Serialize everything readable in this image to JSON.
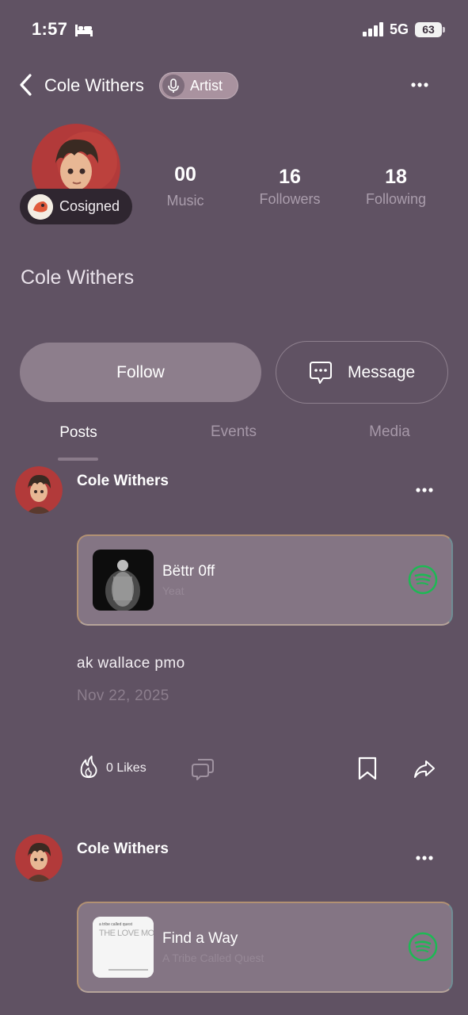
{
  "status_bar": {
    "time": "1:57",
    "network": "5G",
    "battery": "63"
  },
  "header": {
    "title": "Cole Withers",
    "badge": "Artist"
  },
  "profile": {
    "name": "Cole Withers",
    "cosigned_label": "Cosigned",
    "stats": [
      {
        "value": "00",
        "label": "Music"
      },
      {
        "value": "16",
        "label": "Followers"
      },
      {
        "value": "18",
        "label": "Following"
      }
    ]
  },
  "actions": {
    "follow": "Follow",
    "message": "Message"
  },
  "tabs": [
    "Posts",
    "Events",
    "Media"
  ],
  "active_tab": "Posts",
  "posts": [
    {
      "author": "Cole Withers",
      "track": {
        "title": "Bëttr 0ff",
        "artist": "Yeat"
      },
      "text": "ak wallace pmo",
      "date": "Nov 22, 2025",
      "likes": "0 Likes"
    },
    {
      "author": "Cole Withers",
      "track": {
        "title": "Find a Way",
        "artist": "A Tribe Called Quest",
        "art_text": "THE LOVE MOVEMENT",
        "art_small_text": "a tribe called quest"
      }
    }
  ],
  "colors": {
    "background": "#605263",
    "accent_follow": "#8d7e8c",
    "spotify": "#1db954"
  }
}
